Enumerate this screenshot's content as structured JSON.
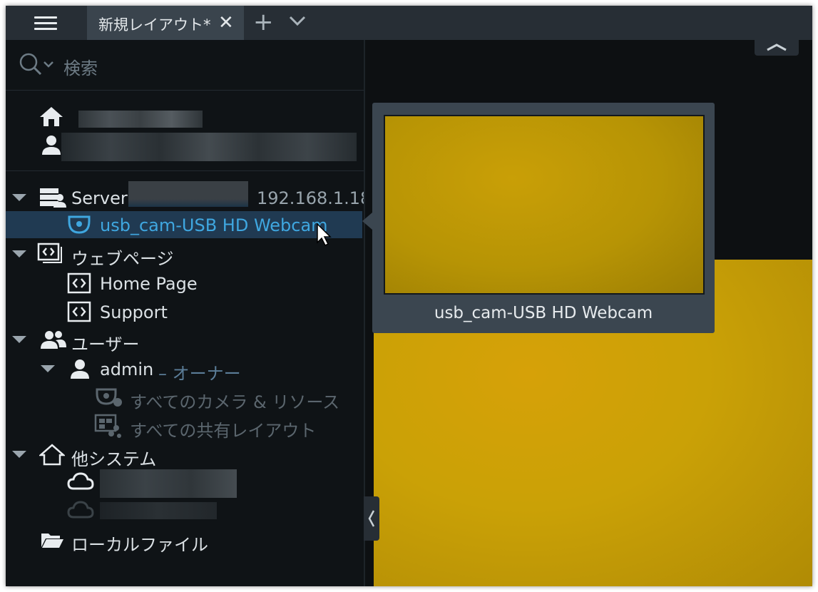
{
  "topbar": {
    "tab_title": "新規レイアウト*",
    "close_glyph": "✕",
    "add_glyph": "+"
  },
  "search": {
    "placeholder": "検索"
  },
  "tree": {
    "server_label": "Server",
    "server_ip": "192.168.1.18",
    "camera_label": "usb_cam-USB HD Webcam",
    "webpages_label": "ウェブページ",
    "home_page_label": "Home Page",
    "support_label": "Support",
    "users_label": "ユーザー",
    "admin_label": "admin",
    "admin_role": "– オーナー",
    "all_cameras_label": "すべてのカメラ & リソース",
    "all_layouts_label": "すべての共有レイアウト",
    "other_systems_label": "他システム",
    "local_files_label": "ローカルファイル"
  },
  "tooltip": {
    "label": "usb_cam-USB HD Webcam"
  },
  "colors": {
    "accent": "#3fa7e0",
    "selection": "#203a52",
    "video": "#caa106"
  },
  "icons": [
    "hamburger-menu-icon",
    "search-icon",
    "chevron-down-icon",
    "home-icon",
    "user-icon",
    "server-icon",
    "camera-icon",
    "webpages-icon",
    "webpage-icon",
    "users-icon",
    "cloud-icon",
    "folder-icon",
    "cursor-icon"
  ]
}
